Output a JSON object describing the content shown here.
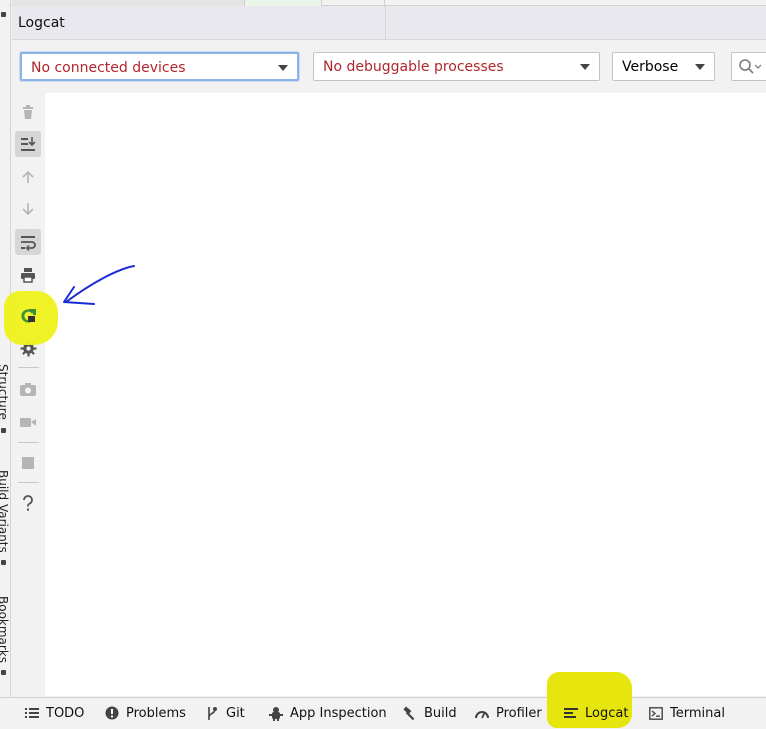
{
  "panel": {
    "title": "Logcat"
  },
  "toolbar": {
    "device_combo": "No connected devices",
    "process_combo": "No debuggable processes",
    "level_combo": "Verbose"
  },
  "side_tabs": [
    "Structure",
    "Build Variants",
    "Bookmarks"
  ],
  "bottom_tabs": [
    {
      "label": "TODO",
      "icon": "list-icon"
    },
    {
      "label": "Problems",
      "icon": "problems-icon"
    },
    {
      "label": "Git",
      "icon": "branch-icon"
    },
    {
      "label": "App Inspection",
      "icon": "inspection-icon"
    },
    {
      "label": "Build",
      "icon": "hammer-icon"
    },
    {
      "label": "Profiler",
      "icon": "gauge-icon"
    },
    {
      "label": "Logcat",
      "icon": "logcat-icon"
    },
    {
      "label": "Terminal",
      "icon": "terminal-icon"
    }
  ],
  "colors": {
    "highlight": "#eef21a",
    "annotation_arrow": "#1a2bd6",
    "error_text": "#b1262b",
    "focus_border": "#8fb2e6"
  }
}
